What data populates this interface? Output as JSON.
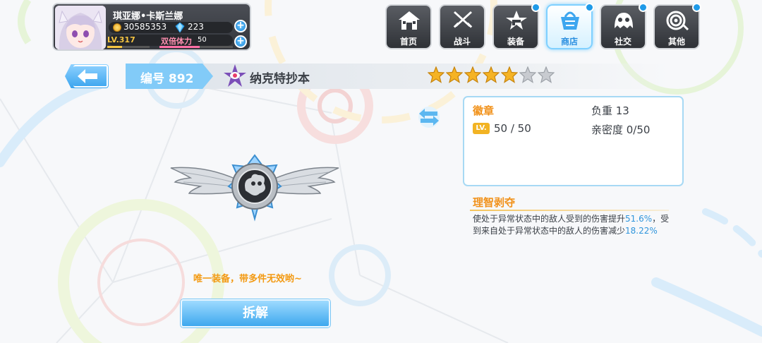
{
  "player": {
    "name": "琪亚娜•卡斯兰娜",
    "gold": "30585353",
    "crystals": "223",
    "level": "LV.317",
    "stamina_label": "双倍体力",
    "stamina_value": "50",
    "exp_fraction": 0.35,
    "stamina_fraction": 0.55
  },
  "nav": {
    "items": [
      {
        "label": "首页",
        "icon": "house-icon",
        "badge": false
      },
      {
        "label": "战斗",
        "icon": "crossed-swords-icon",
        "badge": false
      },
      {
        "label": "装备",
        "icon": "star-gun-icon",
        "badge": true
      },
      {
        "label": "商店",
        "icon": "shopping-basket-icon",
        "badge": true,
        "active": true
      },
      {
        "label": "社交",
        "icon": "ghost-face-icon",
        "badge": true
      },
      {
        "label": "其他",
        "icon": "spiral-icon",
        "badge": true
      }
    ]
  },
  "item": {
    "number": "编号 892",
    "name": "纳克特抄本",
    "stars_filled": 5,
    "stars_total": 7,
    "unique_note": "唯一装备，带多件无效哟~",
    "dismantle_label": "拆解"
  },
  "info": {
    "category": "徽章",
    "weight": "负重 13",
    "lv_chip": "LV.",
    "level": "50 / 50",
    "intimacy": "亲密度 0/50"
  },
  "skill": {
    "name": "理智剥夺",
    "desc_1": "使处于异常状态中的敌人受到的伤害提升",
    "value_1": "51.6%",
    "desc_2": "，受到来自处于异常状态中的敌人的伤害减少",
    "value_2": "18.22%"
  },
  "colors": {
    "accent_blue": "#3ea8ee",
    "highlight_orange": "#f1921b",
    "star_gold": "#f5b324",
    "star_empty": "#c8cbd0"
  }
}
